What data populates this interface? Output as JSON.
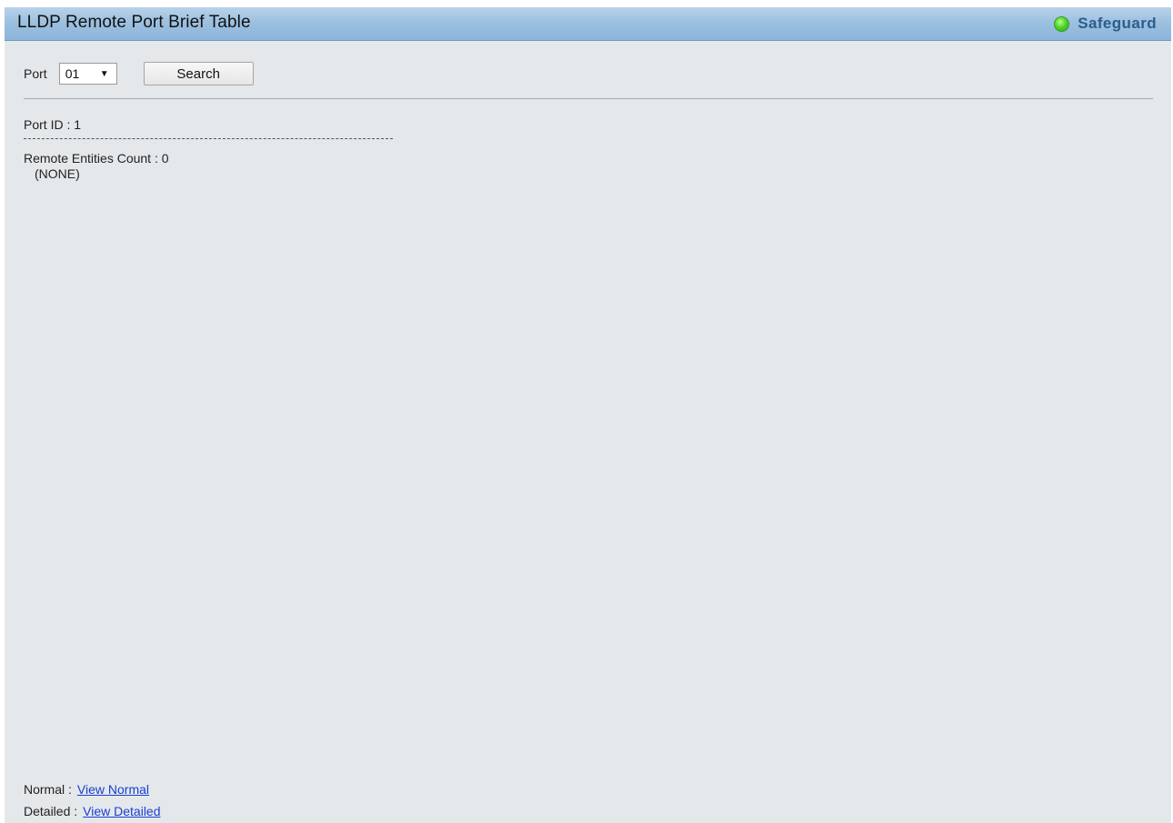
{
  "header": {
    "title": "LLDP Remote Port Brief Table",
    "status_label": "Safeguard",
    "status_icon": "green-led-icon",
    "status_color": "#4fd62a"
  },
  "search": {
    "port_label": "Port",
    "port_selected": "01",
    "search_button": "Search"
  },
  "result": {
    "port_id": "Port ID : 1",
    "remote_entities_count": "Remote Entities Count : 0",
    "entities": "(NONE)"
  },
  "footer": {
    "normal_label": "Normal :",
    "normal_link": "View Normal",
    "detailed_label": "Detailed :",
    "detailed_link": "View Detailed"
  }
}
